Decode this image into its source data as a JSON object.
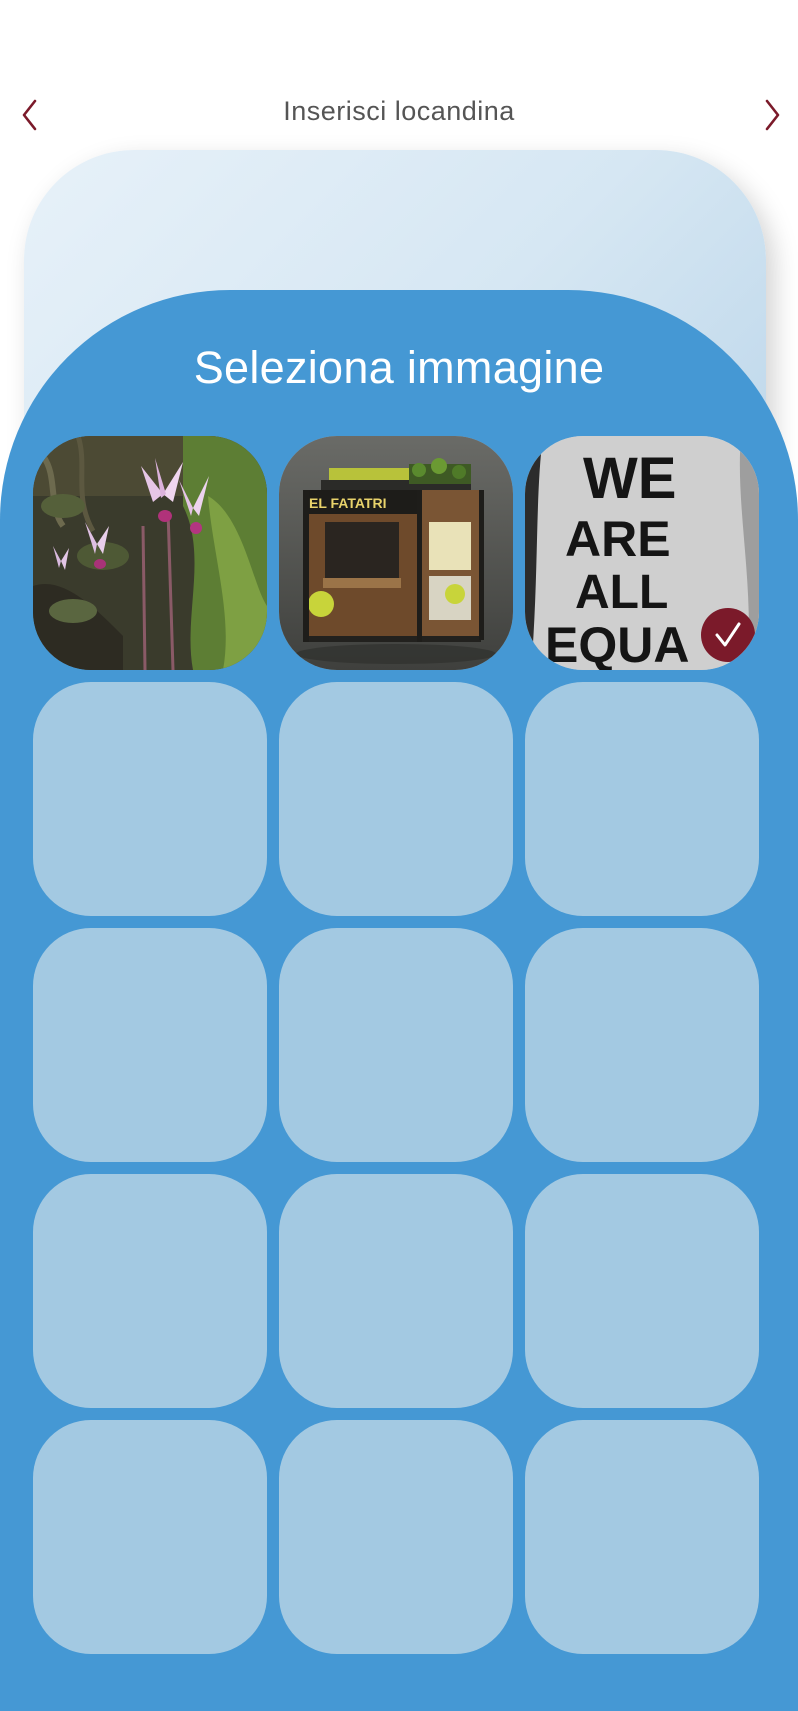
{
  "header": {
    "title": "Inserisci locandina",
    "back_icon": "chevron-left-icon",
    "forward_icon": "chevron-right-icon"
  },
  "sheet": {
    "title": "Seleziona immagine"
  },
  "images": [
    {
      "subject": "pink cyclamen flowers",
      "selected": false
    },
    {
      "subject": "kiosk storefront",
      "sign_text": "EL FATATRI",
      "selected": false
    },
    {
      "subject": "hand with handwritten words",
      "hand_text": [
        "WE",
        "ARE",
        "ALL",
        "EQUA"
      ],
      "selected": true
    }
  ],
  "empty_slots": 12,
  "colors": {
    "accent": "#7b1a2a",
    "sheet": "#4598d4",
    "slot": "#a3c9e2"
  }
}
